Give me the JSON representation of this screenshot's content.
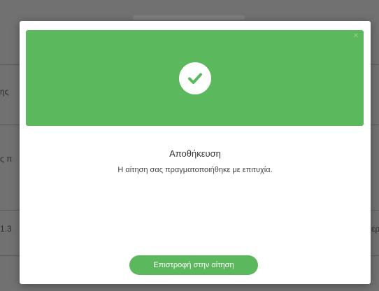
{
  "background": {
    "left_fragments": [
      "ης",
      "ς π",
      "1.3"
    ],
    "right_fragments": [
      "ερ"
    ]
  },
  "modal": {
    "close_glyph": "✕",
    "title": "Αποθήκευση",
    "message": "Η αίτηση σας πραγματοποιήθηκε με επιτυχία.",
    "button_label": "Επιστροφή στην αίτηση"
  },
  "colors": {
    "success_green": "#5cb85c",
    "check_mark": "#5cb85c"
  },
  "icons": {
    "header": "checkmark-circle-icon",
    "close": "close-icon"
  }
}
